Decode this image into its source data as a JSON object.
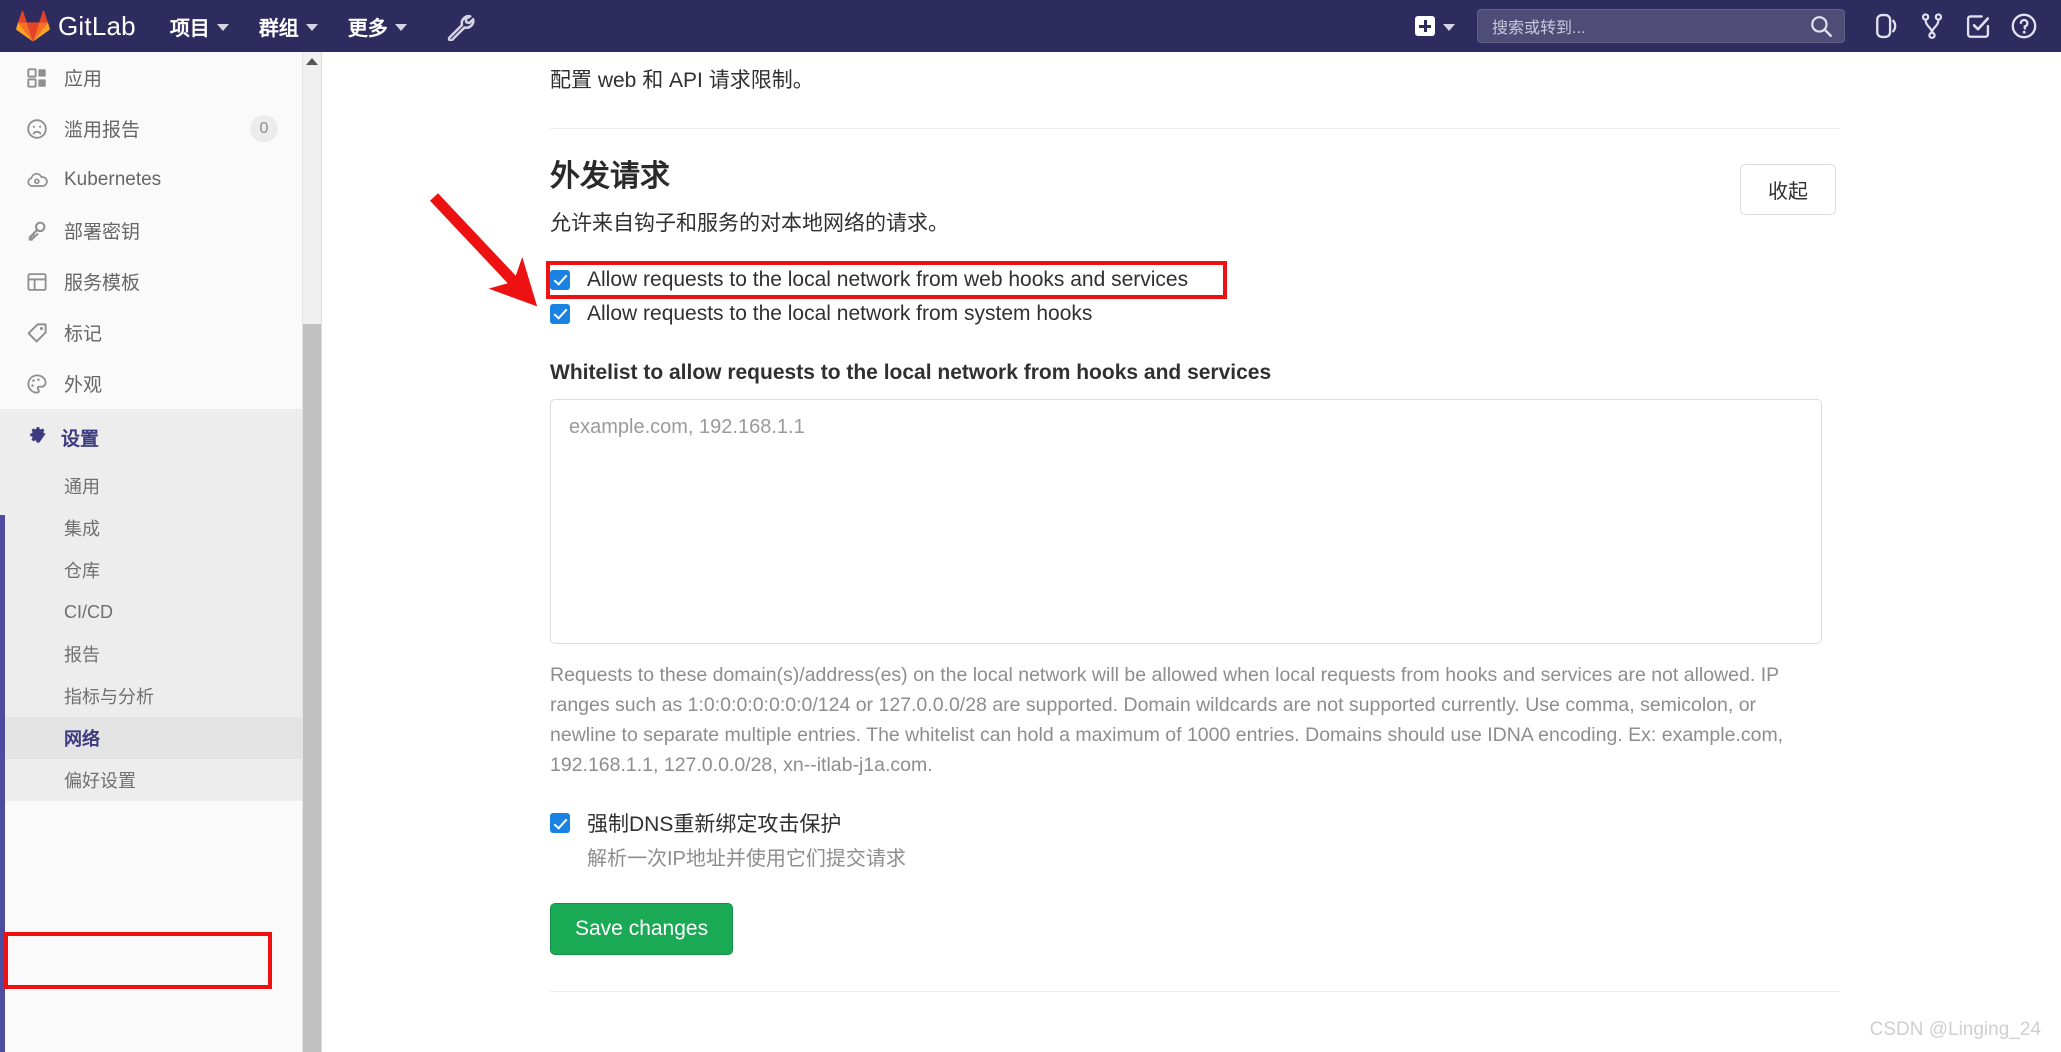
{
  "navbar": {
    "brand": "GitLab",
    "logo_icon": "gitlab-tanuki-logo",
    "items": [
      {
        "label": "项目",
        "icon": "chevron-down-icon"
      },
      {
        "label": "群组",
        "icon": "chevron-down-icon"
      },
      {
        "label": "更多",
        "icon": "chevron-down-icon"
      }
    ],
    "admin_icon": "wrench-icon",
    "create_new": {
      "icon": "plus-icon",
      "chevron": "chevron-down-icon"
    },
    "search": {
      "placeholder": "搜索或转到...",
      "value": "",
      "icon": "search-icon"
    },
    "right_icons": [
      {
        "name": "issues-icon"
      },
      {
        "name": "merge-requests-icon"
      },
      {
        "name": "todos-icon"
      },
      {
        "name": "help-icon"
      }
    ]
  },
  "sidebar": {
    "items": [
      {
        "label": "应用",
        "icon": "applications-icon",
        "badge": ""
      },
      {
        "label": "滥用报告",
        "icon": "abuse-report-icon",
        "badge": "0"
      },
      {
        "label": "Kubernetes",
        "icon": "kubernetes-icon",
        "badge": ""
      },
      {
        "label": "部署密钥",
        "icon": "key-icon",
        "badge": ""
      },
      {
        "label": "服务模板",
        "icon": "template-icon",
        "badge": ""
      },
      {
        "label": "标记",
        "icon": "label-tag-icon",
        "badge": ""
      },
      {
        "label": "外观",
        "icon": "appearance-palette-icon",
        "badge": ""
      }
    ],
    "settings": {
      "label": "设置",
      "icon": "gear-icon",
      "sub_items": [
        {
          "label": "通用",
          "active": false
        },
        {
          "label": "集成",
          "active": false
        },
        {
          "label": "仓库",
          "active": false
        },
        {
          "label": "CI/CD",
          "active": false
        },
        {
          "label": "报告",
          "active": false
        },
        {
          "label": "指标与分析",
          "active": false
        },
        {
          "label": "网络",
          "active": true
        },
        {
          "label": "偏好设置",
          "active": false
        }
      ]
    },
    "scrollbar": {
      "up_arrow_icon": "scroll-up-arrow-icon"
    }
  },
  "main": {
    "lead_text": "配置 web 和 API 请求限制。",
    "section": {
      "title": "外发请求",
      "description": "允许来自钩子和服务的对本地网络的请求。",
      "collapse_label": "收起"
    },
    "checkboxes": [
      {
        "label": "Allow requests to the local network from web hooks and services",
        "checked": true
      },
      {
        "label": "Allow requests to the local network from system hooks",
        "checked": true
      }
    ],
    "whitelist": {
      "label": "Whitelist to allow requests to the local network from hooks and services",
      "placeholder": "example.com, 192.168.1.1",
      "value": "",
      "help_text": "Requests to these domain(s)/address(es) on the local network will be allowed when local requests from hooks and services are not allowed. IP ranges such as 1:0:0:0:0:0:0:0/124 or 127.0.0.0/28 are supported. Domain wildcards are not supported currently. Use comma, semicolon, or newline to separate multiple entries. The whitelist can hold a maximum of 1000 entries. Domains should use IDNA encoding. Ex: example.com, 192.168.1.1, 127.0.0.0/28, xn--itlab-j1a.com."
    },
    "dns_option": {
      "label": "强制DNS重新绑定攻击保护",
      "sub_label": "解析一次IP地址并使用它们提交请求",
      "checked": true
    },
    "save_label": "Save changes"
  },
  "annotations": {
    "arrow_color": "#ee1111",
    "box_color": "#ee1111"
  },
  "watermark": "CSDN @Linging_24",
  "colors": {
    "navbar_bg": "#2e2c5e",
    "accent_purple": "#4f4ba0",
    "checkbox_blue": "#1a82e2",
    "save_green": "#1aaa55",
    "annotation_red": "#ee1111"
  }
}
